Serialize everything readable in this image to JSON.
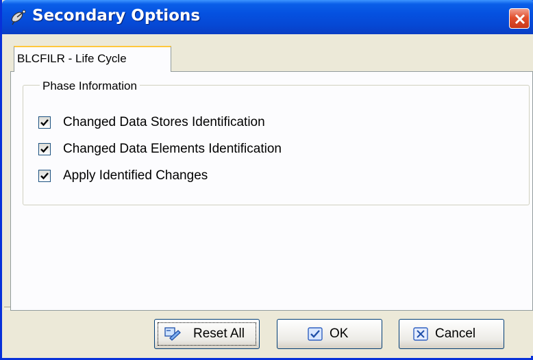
{
  "window": {
    "title": "Secondary Options"
  },
  "tab": {
    "label": "BLCFILR - Life Cycle"
  },
  "phase_group": {
    "label": "Phase Information",
    "items": [
      {
        "label": "Changed Data Stores Identification",
        "checked": true
      },
      {
        "label": "Changed Data Elements Identification",
        "checked": true
      },
      {
        "label": "Apply Identified Changes",
        "checked": true
      }
    ]
  },
  "buttons": {
    "reset_label": "Reset All",
    "ok_label": "OK",
    "cancel_label": "Cancel"
  },
  "icons": {
    "title": "satellite-icon",
    "close": "close-icon",
    "reset": "reset-icon",
    "ok": "ok-check-icon",
    "cancel": "cancel-x-icon"
  },
  "colors": {
    "titlebar": "#0551e0",
    "close_button": "#e2502e",
    "tab_highlight": "#ffc83c",
    "dialog_bg": "#ece9d8"
  }
}
